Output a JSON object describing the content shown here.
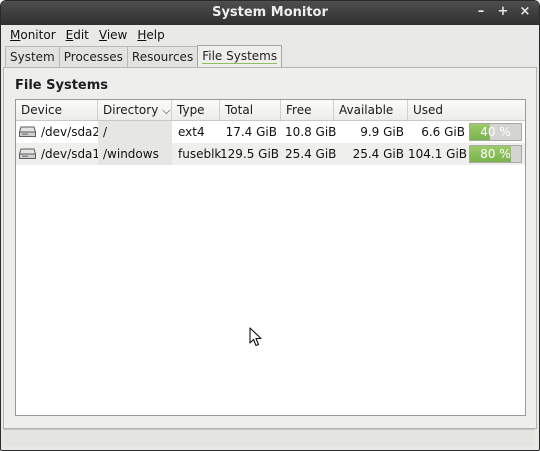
{
  "window": {
    "title": "System Monitor",
    "controls": [
      "–",
      "+",
      "×"
    ]
  },
  "menu": [
    {
      "mnemonic": "M",
      "rest": "onitor"
    },
    {
      "mnemonic": "E",
      "rest": "dit"
    },
    {
      "mnemonic": "V",
      "rest": "iew"
    },
    {
      "mnemonic": "H",
      "rest": "elp"
    }
  ],
  "tabs": [
    {
      "label": "System"
    },
    {
      "label": "Processes"
    },
    {
      "label": "Resources"
    },
    {
      "label": "File Systems"
    }
  ],
  "section_title": "File Systems",
  "table": {
    "columns": [
      "Device",
      "Directory",
      "Type",
      "Total",
      "Free",
      "Available",
      "Used"
    ],
    "sort_indicator": "⌵",
    "rows": [
      {
        "device": "/dev/sda2",
        "directory": "/",
        "type": "ext4",
        "total": "17.4 GiB",
        "free": "10.8 GiB",
        "available": "9.9 GiB",
        "used": "6.6 GiB",
        "used_pct_label": "40 %",
        "used_fraction": 0.4
      },
      {
        "device": "/dev/sda1",
        "directory": "/windows",
        "type": "fuseblk",
        "total": "129.5 GiB",
        "free": "25.4 GiB",
        "available": "25.4 GiB",
        "used": "104.1 GiB",
        "used_pct_label": "80 %",
        "used_fraction": 0.8
      }
    ]
  },
  "icons": {
    "drive": "harddisk-icon",
    "cursor": "mouse-pointer-icon"
  },
  "colors": {
    "usage_bar_fill": "#86bd55",
    "active_tab_underline": "#8fbf5a"
  }
}
